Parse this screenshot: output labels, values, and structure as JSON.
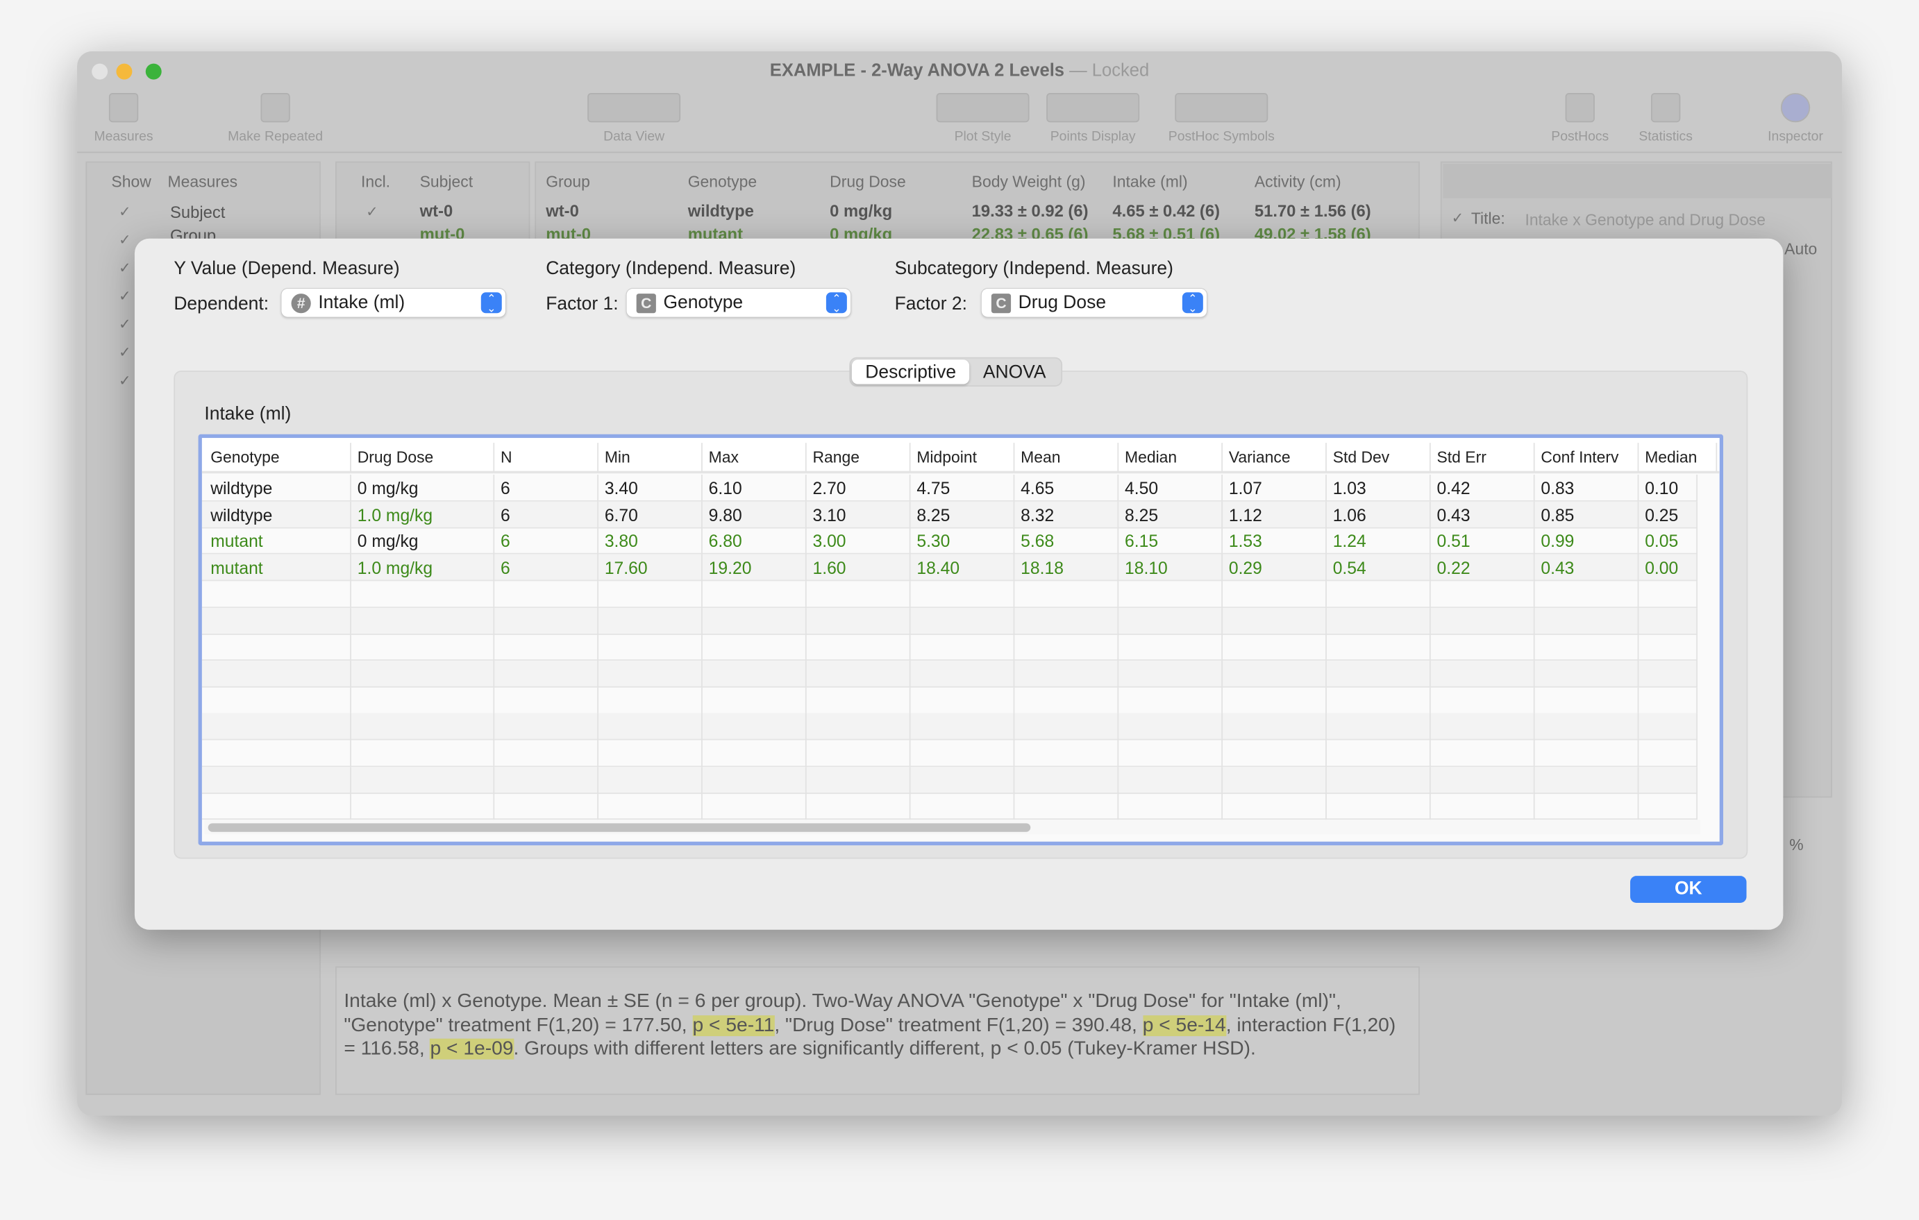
{
  "window": {
    "title": "EXAMPLE - 2-Way ANOVA 2 Levels",
    "status": "— Locked"
  },
  "toolbar": [
    {
      "label": "Measures",
      "icon": "measures-icon"
    },
    {
      "label": "Make Repeated",
      "icon": "make-repeated-icon"
    },
    {
      "label": "Data View",
      "icon": "data-view-icon"
    },
    {
      "label": "Plot Style",
      "icon": "plot-style-icon"
    },
    {
      "label": "Points Display",
      "icon": "points-display-icon"
    },
    {
      "label": "PostHoc Symbols",
      "icon": "posthoc-symbols-icon"
    },
    {
      "label": "PostHocs",
      "icon": "posthocs-icon"
    },
    {
      "label": "Statistics",
      "icon": "statistics-icon"
    },
    {
      "label": "Inspector",
      "icon": "inspector-icon"
    }
  ],
  "measures_panel": {
    "headers": [
      "Show",
      "Measures"
    ],
    "items": [
      "Subject",
      "Group"
    ]
  },
  "subjects_panel": {
    "headers": [
      "Incl.",
      "Subject"
    ],
    "items": [
      "wt-0",
      "mut-0"
    ]
  },
  "data_table": {
    "headers": [
      "Group",
      "Genotype",
      "Drug Dose",
      "Body Weight (g)",
      "Intake (ml)",
      "Activity (cm)"
    ],
    "rows": [
      [
        "wt-0",
        "wildtype",
        "0 mg/kg",
        "19.33 ± 0.92 (6)",
        "4.65 ± 0.42 (6)",
        "51.70 ± 1.56 (6)"
      ],
      [
        "mut-0",
        "mutant",
        "0 mg/kg",
        "22.83 ± 0.65 (6)",
        "5.68 ± 0.51 (6)",
        "49.02 ± 1.58 (6)"
      ]
    ]
  },
  "inspector": {
    "title_label": "Title:",
    "title_value": "Intake x Genotype and Drug Dose",
    "auto": "Auto",
    "percent": "%"
  },
  "dialog": {
    "y_heading": "Y Value (Depend. Measure)",
    "cat_heading": "Category (Independ. Measure)",
    "subcat_heading": "Subcategory (Independ. Measure)",
    "dependent_label": "Dependent:",
    "dependent_value": "Intake (ml)",
    "factor1_label": "Factor 1:",
    "factor1_value": "Genotype",
    "factor2_label": "Factor 2:",
    "factor2_value": "Drug Dose",
    "tabs": [
      {
        "label": "Descriptive",
        "selected": true
      },
      {
        "label": "ANOVA",
        "selected": false
      }
    ],
    "table_title": "Intake (ml)",
    "columns": [
      "Genotype",
      "Drug Dose",
      "N",
      "Min",
      "Max",
      "Range",
      "Midpoint",
      "Mean",
      "Median",
      "Variance",
      "Std Dev",
      "Std Err",
      "Conf Interv",
      "Median"
    ],
    "rows": [
      {
        "cells": [
          "wildtype",
          "0 mg/kg",
          "6",
          "3.40",
          "6.10",
          "2.70",
          "4.75",
          "4.65",
          "4.50",
          "1.07",
          "1.03",
          "0.42",
          "0.83",
          "0.10"
        ],
        "green": [
          false,
          false,
          false,
          false,
          false,
          false,
          false,
          false,
          false,
          false,
          false,
          false,
          false,
          false
        ]
      },
      {
        "cells": [
          "wildtype",
          "1.0 mg/kg",
          "6",
          "6.70",
          "9.80",
          "3.10",
          "8.25",
          "8.32",
          "8.25",
          "1.12",
          "1.06",
          "0.43",
          "0.85",
          "0.25"
        ],
        "green": [
          false,
          true,
          false,
          false,
          false,
          false,
          false,
          false,
          false,
          false,
          false,
          false,
          false,
          false
        ]
      },
      {
        "cells": [
          "mutant",
          "0 mg/kg",
          "6",
          "3.80",
          "6.80",
          "3.00",
          "5.30",
          "5.68",
          "6.15",
          "1.53",
          "1.24",
          "0.51",
          "0.99",
          "0.05"
        ],
        "green": [
          true,
          false,
          true,
          true,
          true,
          true,
          true,
          true,
          true,
          true,
          true,
          true,
          true,
          true
        ]
      },
      {
        "cells": [
          "mutant",
          "1.0 mg/kg",
          "6",
          "17.60",
          "19.20",
          "1.60",
          "18.40",
          "18.18",
          "18.10",
          "0.29",
          "0.54",
          "0.22",
          "0.43",
          "0.00"
        ],
        "green": [
          true,
          true,
          true,
          true,
          true,
          true,
          true,
          true,
          true,
          true,
          true,
          true,
          true,
          true
        ]
      }
    ],
    "ok_label": "OK"
  },
  "caption": {
    "p1": "Intake (ml) x Genotype.  Mean ± SE (n = 6 per group). Two-Way ANOVA \"Genotype\" x \"Drug Dose\" for \"Intake (ml)\", \"Genotype\" treatment F(1,20) = 177.50, ",
    "h1": "p < 5e-11",
    "p2": ", \"Drug Dose\" treatment F(1,20) = 390.48, ",
    "h2": "p < 5e-14",
    "p3": ", interaction F(1,20) = 116.58, ",
    "h3": "p < 1e-09",
    "p4": ". Groups with different letters are significantly different, p < 0.05 (Tukey-Kramer HSD)."
  },
  "colors": {
    "accent": "#3a82f7",
    "green_text": "#3d8a1a",
    "highlight": "#cfcf7a",
    "table_border": "#8ea8e8"
  }
}
